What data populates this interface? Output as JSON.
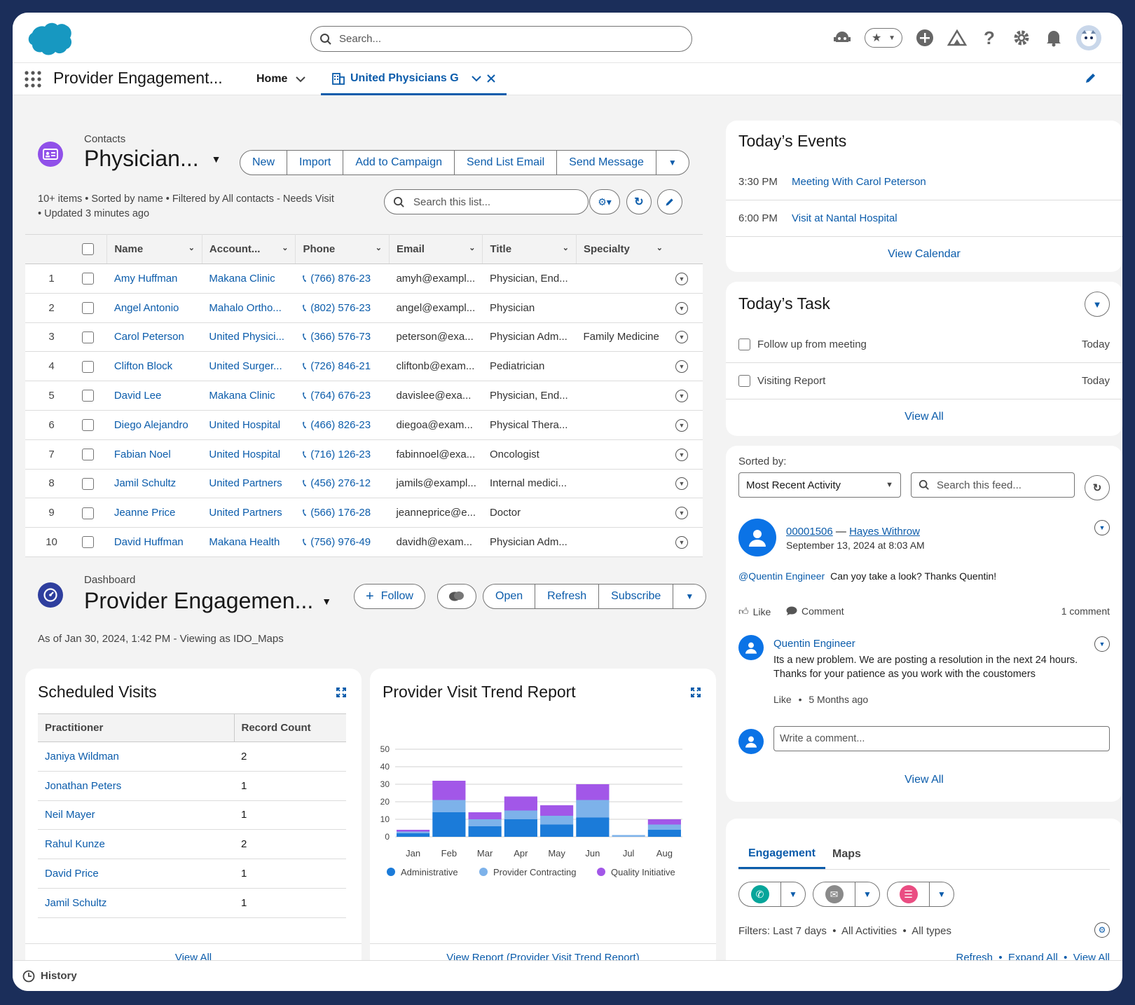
{
  "global": {
    "search_placeholder": "Search..."
  },
  "nav": {
    "app_name": "Provider Engagement...",
    "home_tab": "Home",
    "record_tab": "United Physicians G"
  },
  "list_view": {
    "object_label": "Contacts",
    "title": "Physician...",
    "buttons": [
      "New",
      "Import",
      "Add to Campaign",
      "Send List Email",
      "Send Message"
    ],
    "meta_line1": "10+ items  •  Sorted by name  •  Filtered by All contacts - Needs Visit",
    "meta_line2": "•  Updated 3 minutes ago",
    "search_placeholder": "Search this list...",
    "columns": [
      "Name",
      "Account...",
      "Phone",
      "Email",
      "Title",
      "Specialty"
    ],
    "rows": [
      {
        "n": "1",
        "name": "Amy Huffman",
        "account": "Makana Clinic",
        "phone": "(766) 876-23",
        "email": "amyh@exampl...",
        "title": "Physician, End...",
        "specialty": ""
      },
      {
        "n": "2",
        "name": "Angel Antonio",
        "account": "Mahalo Ortho...",
        "phone": "(802) 576-23",
        "email": "angel@exampl...",
        "title": "Physician",
        "specialty": ""
      },
      {
        "n": "3",
        "name": "Carol Peterson",
        "account": "United Physici...",
        "phone": "(366) 576-73",
        "email": "peterson@exa...",
        "title": "Physician Adm...",
        "specialty": "Family Medicine"
      },
      {
        "n": "4",
        "name": "Clifton Block",
        "account": "United Surger...",
        "phone": "(726) 846-21",
        "email": "cliftonb@exam...",
        "title": "Pediatrician",
        "specialty": ""
      },
      {
        "n": "5",
        "name": "David Lee",
        "account": "Makana Clinic",
        "phone": "(764) 676-23",
        "email": "davislee@exa...",
        "title": "Physician, End...",
        "specialty": ""
      },
      {
        "n": "6",
        "name": "Diego Alejandro",
        "account": "United Hospital",
        "phone": "(466) 826-23",
        "email": "diegoa@exam...",
        "title": "Physical Thera...",
        "specialty": ""
      },
      {
        "n": "7",
        "name": "Fabian Noel",
        "account": "United Hospital",
        "phone": "(716) 126-23",
        "email": "fabinnoel@exa...",
        "title": "Oncologist",
        "specialty": ""
      },
      {
        "n": "8",
        "name": "Jamil Schultz",
        "account": "United Partners",
        "phone": "(456) 276-12",
        "email": "jamils@exampl...",
        "title": "Internal medici...",
        "specialty": ""
      },
      {
        "n": "9",
        "name": "Jeanne Price",
        "account": "United Partners",
        "phone": "(566) 176-28",
        "email": "jeanneprice@e...",
        "title": "Doctor",
        "specialty": ""
      },
      {
        "n": "10",
        "name": "David Huffman",
        "account": "Makana Health",
        "phone": "(756) 976-49",
        "email": "davidh@exam...",
        "title": "Physician Adm...",
        "specialty": ""
      }
    ]
  },
  "dashboard": {
    "label": "Dashboard",
    "title": "Provider Engagemen...",
    "follow": "Follow",
    "buttons": [
      "Open",
      "Refresh",
      "Subscribe"
    ],
    "meta": "As of Jan 30, 2024, 1:42 PM - Viewing as IDO_Maps"
  },
  "scheduled_visits": {
    "title": "Scheduled Visits",
    "col1": "Practitioner",
    "col2": "Record Count",
    "rows": [
      {
        "name": "Janiya Wildman",
        "count": "2"
      },
      {
        "name": "Jonathan Peters",
        "count": "1"
      },
      {
        "name": "Neil Mayer",
        "count": "1"
      },
      {
        "name": "Rahul Kunze",
        "count": "2"
      },
      {
        "name": "David Price",
        "count": "1"
      },
      {
        "name": "Jamil Schultz",
        "count": "1"
      }
    ],
    "footer": "View All"
  },
  "trend_report": {
    "title": "Provider Visit Trend Report",
    "footer": "View Report (Provider Visit Trend Report)"
  },
  "chart_data": {
    "type": "bar",
    "stacked": true,
    "title": "Provider Visit Trend Report",
    "categories": [
      "Jan",
      "Feb",
      "Mar",
      "Apr",
      "May",
      "Jun",
      "Jul",
      "Aug"
    ],
    "series": [
      {
        "name": "Administrative",
        "color": "#1b7bd9",
        "values": [
          2,
          14,
          6,
          10,
          7,
          11,
          0,
          4
        ]
      },
      {
        "name": "Provider Contracting",
        "color": "#7db2ea",
        "values": [
          1,
          7,
          4,
          5,
          5,
          10,
          1,
          3
        ]
      },
      {
        "name": "Quality Initiative",
        "color": "#a257e8",
        "values": [
          1,
          11,
          4,
          8,
          6,
          9,
          0,
          3
        ]
      }
    ],
    "yticks": [
      0,
      10,
      20,
      30,
      40,
      50
    ],
    "ylim": [
      0,
      50
    ],
    "grid": true,
    "legend": "bottom"
  },
  "events": {
    "title": "Today’s Events",
    "items": [
      {
        "time": "3:30 PM",
        "label": "Meeting With Carol Peterson"
      },
      {
        "time": "6:00 PM",
        "label": "Visit at Nantal Hospital"
      }
    ],
    "footer": "View Calendar"
  },
  "tasks": {
    "title": "Today’s Task",
    "items": [
      {
        "label": "Follow up from meeting",
        "due": "Today"
      },
      {
        "label": "Visiting Report",
        "due": "Today"
      }
    ],
    "footer": "View All"
  },
  "feed": {
    "sorted_label": "Sorted by:",
    "sort_value": "Most Recent Activity",
    "search_placeholder": "Search this feed...",
    "post_id": "00001506",
    "post_dash": "—",
    "post_author": "Hayes Withrow",
    "post_date": "September 13, 2024 at 8:03 AM",
    "mention": "@Quentin Engineer",
    "body": "Can yoy take a look? Thanks Quentin!",
    "like": "Like",
    "comment": "Comment",
    "comment_count": "1 comment",
    "commenter": "Quentin Engineer",
    "comment_text": "Its a new problem. We are posting a resolution in the next 24 hours. Thanks for your patience as you work with the coustomers",
    "comment_like": "Like",
    "comment_age": "5 Months ago",
    "write_placeholder": "Write a comment...",
    "footer": "View All"
  },
  "activity": {
    "tabs": [
      "Engagement",
      "Maps"
    ],
    "filters": "Filters: Last 7 days  •  All Activities  •  All types",
    "links": "Refresh  •  Expand All  •  View All"
  },
  "history": "History",
  "colors": {
    "brand": "#0b5cab",
    "sf_cloud": "#1798c1",
    "contacts_icon": "#9050e9"
  }
}
